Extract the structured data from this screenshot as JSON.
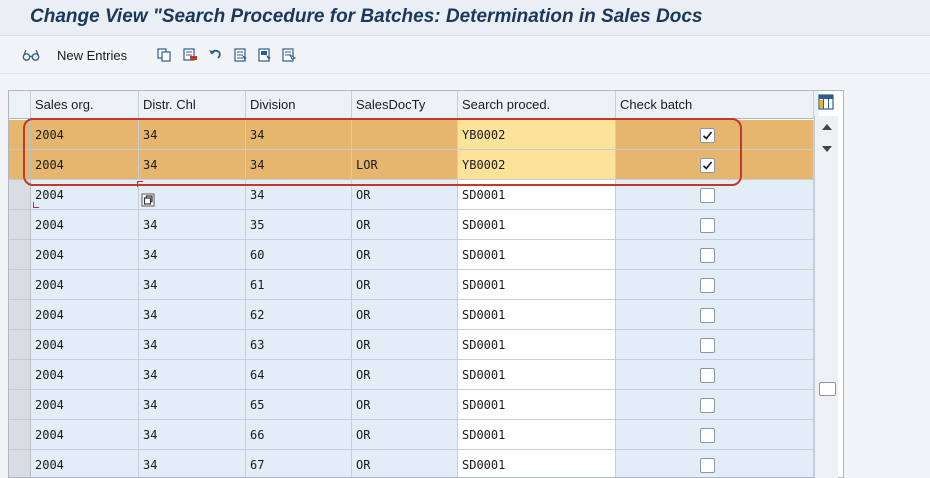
{
  "title": "Change View \"Search Procedure for Batches: Determination in Sales Docs",
  "toolbar": {
    "new_entries_label": "New Entries",
    "icons": [
      "glasses-icon",
      "copy-icon",
      "delete-icon",
      "undo-icon",
      "select-all-icon",
      "select-block-icon",
      "deselect-all-icon"
    ]
  },
  "table": {
    "columns": [
      "Sales org.",
      "Distr. Chl",
      "Division",
      "SalesDocTy",
      "Search proced.",
      "Check batch"
    ],
    "rows": [
      {
        "sales_org": "2004",
        "distr_chl": "34",
        "division": "34",
        "sales_doc_ty": "",
        "search_proced": "YB0002",
        "check_batch": true,
        "highlight": true
      },
      {
        "sales_org": "2004",
        "distr_chl": "34",
        "division": "34",
        "sales_doc_ty": "LOR",
        "search_proced": "YB0002",
        "check_batch": true,
        "highlight": true
      },
      {
        "sales_org": "2004",
        "distr_chl": "",
        "division": "34",
        "sales_doc_ty": "OR",
        "search_proced": "SD0001",
        "check_batch": false,
        "highlight": false
      },
      {
        "sales_org": "2004",
        "distr_chl": "34",
        "division": "35",
        "sales_doc_ty": "OR",
        "search_proced": "SD0001",
        "check_batch": false,
        "highlight": false
      },
      {
        "sales_org": "2004",
        "distr_chl": "34",
        "division": "60",
        "sales_doc_ty": "OR",
        "search_proced": "SD0001",
        "check_batch": false,
        "highlight": false
      },
      {
        "sales_org": "2004",
        "distr_chl": "34",
        "division": "61",
        "sales_doc_ty": "OR",
        "search_proced": "SD0001",
        "check_batch": false,
        "highlight": false
      },
      {
        "sales_org": "2004",
        "distr_chl": "34",
        "division": "62",
        "sales_doc_ty": "OR",
        "search_proced": "SD0001",
        "check_batch": false,
        "highlight": false
      },
      {
        "sales_org": "2004",
        "distr_chl": "34",
        "division": "63",
        "sales_doc_ty": "OR",
        "search_proced": "SD0001",
        "check_batch": false,
        "highlight": false
      },
      {
        "sales_org": "2004",
        "distr_chl": "34",
        "division": "64",
        "sales_doc_ty": "OR",
        "search_proced": "SD0001",
        "check_batch": false,
        "highlight": false
      },
      {
        "sales_org": "2004",
        "distr_chl": "34",
        "division": "65",
        "sales_doc_ty": "OR",
        "search_proced": "SD0001",
        "check_batch": false,
        "highlight": false
      },
      {
        "sales_org": "2004",
        "distr_chl": "34",
        "division": "66",
        "sales_doc_ty": "OR",
        "search_proced": "SD0001",
        "check_batch": false,
        "highlight": false
      },
      {
        "sales_org": "2004",
        "distr_chl": "34",
        "division": "67",
        "sales_doc_ty": "OR",
        "search_proced": "SD0001",
        "check_batch": false,
        "highlight": false
      }
    ]
  },
  "colors": {
    "highlight_row": "#e6b66e",
    "highlight_input": "#fde29a",
    "annotation_box": "#c0392b",
    "title_text": "#1c3759"
  }
}
